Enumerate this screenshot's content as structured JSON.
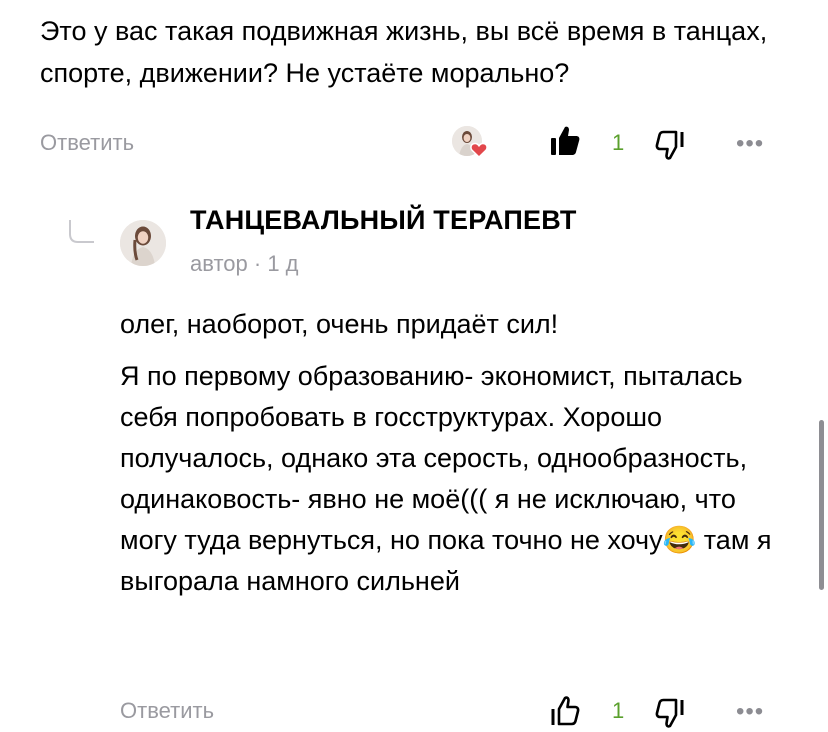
{
  "parent_comment": {
    "text": "Это у вас такая подвижная жизнь, вы всё время в танцах, спорте, движении? Не устаёте морально?",
    "reply_label": "Ответить",
    "likes": "1",
    "more": "•••"
  },
  "reply_comment": {
    "author": "ТАНЦЕВАЛЬНЫЙ ТЕРАПЕВТ",
    "role": "автор",
    "time": "1 д",
    "paragraph1": "олег, наоборот, очень придаёт сил!",
    "paragraph2": "Я по первому образованию- экономист, пыталась себя попробовать в госструктурах. Хорошо получалось, однако эта серость, однообразность, одинаковость- явно не моё((( я не исключаю, что могу туда вернуться, но пока точно не хочу",
    "emoji": "😂",
    "paragraph2_tail": " там я выгорала намного сильней",
    "reply_label": "Ответить",
    "likes": "1",
    "more": "•••"
  },
  "colors": {
    "like_count": "#5aa02c",
    "muted": "#9a9aa0",
    "heart": "#e2474b"
  }
}
